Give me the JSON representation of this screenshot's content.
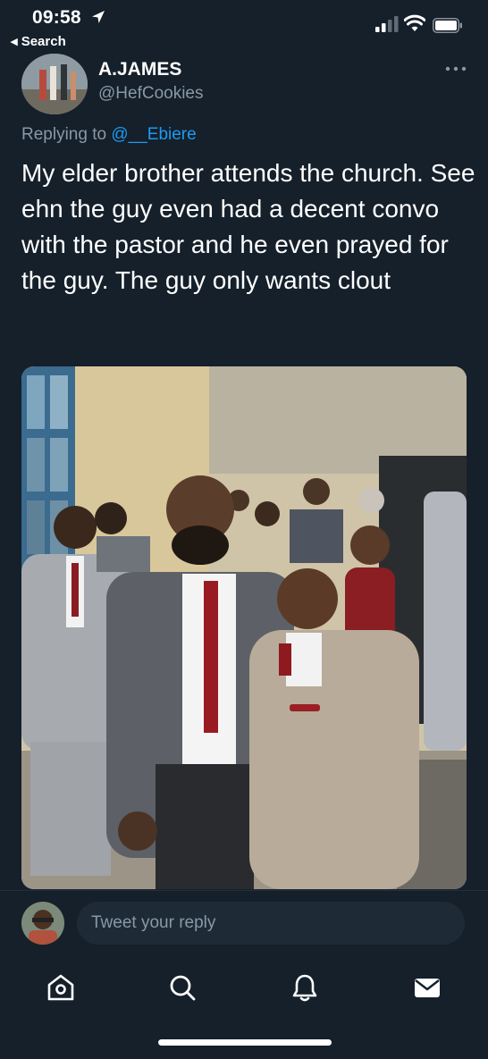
{
  "status_bar": {
    "time": "09:58",
    "back_label": "Search"
  },
  "tweet": {
    "author_name": "A.JAMES",
    "author_handle": "@HefCookies",
    "replying_prefix": "Replying to",
    "replying_to": "@__Ebiere",
    "text": "My elder brother attends the church. See ehn the guy even had a decent convo with the pastor and he even prayed for the guy. The guy only wants clout",
    "photo_icon": "photo-of-men-in-suits"
  },
  "reply": {
    "placeholder": "Tweet your reply"
  },
  "tabbar": {
    "items": [
      {
        "icon": "home-icon"
      },
      {
        "icon": "search-icon"
      },
      {
        "icon": "notifications-icon"
      },
      {
        "icon": "messages-icon"
      }
    ]
  },
  "colors": {
    "background": "#15202b",
    "accent": "#1d9bf0",
    "muted": "#8899a6"
  }
}
